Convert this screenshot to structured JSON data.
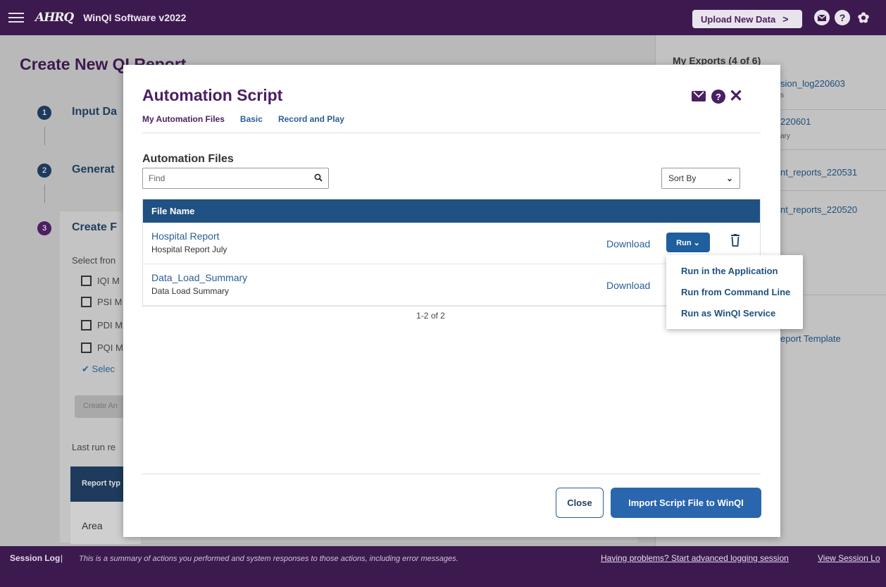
{
  "topbar": {
    "logo": "AHRQ",
    "app_title": "WinQI Software v2022",
    "upload_label": "Upload New Data",
    "upload_chevron": ">",
    "help_glyph": "?",
    "settings_glyph": "✿"
  },
  "background": {
    "page_title": "Create New QI Report",
    "steps": [
      {
        "number": "1",
        "label": "Input Da"
      },
      {
        "number": "2",
        "label": "Generat"
      },
      {
        "number": "3",
        "label": "Create F"
      }
    ],
    "select_from": "Select fron",
    "checkboxes": [
      "IQI M",
      "PSI M",
      "PDI M",
      "PQI M"
    ],
    "select_all": "Selec",
    "create_btn": "Create An",
    "last_run": "Last run re",
    "table_header": "Report typ",
    "table_cell": "Area",
    "right_panel": {
      "title": "My Exports (4 of 6)",
      "items": [
        {
          "name": "sion_log220603",
          "sub": "s"
        },
        {
          "name": "220601",
          "sub": "ary"
        },
        {
          "name": "nt_reports_220531",
          "sub": ""
        },
        {
          "name": "nt_reports_220520",
          "sub": ""
        }
      ],
      "template_link": "eport Template"
    }
  },
  "footer": {
    "label": "Session Log",
    "separator": "|",
    "description": "This is a summary of actions you performed and system responses to those actions, including error messages.",
    "link_problems": "Having problems? Start advanced logging session",
    "link_view": "View Session Lo"
  },
  "modal": {
    "title": "Automation Script",
    "help_glyph": "?",
    "close_glyph": "✕",
    "tabs": [
      "My Automation Files",
      "Basic",
      "Record and Play"
    ],
    "section_title": "Automation Files",
    "search_placeholder": "Find",
    "sort_label": "Sort By",
    "sort_chevron": "⌄",
    "table_header": "File Name",
    "rows": [
      {
        "name": "Hospital Report",
        "description": "Hospital Report July",
        "download": "Download",
        "run": "Run ⌄"
      },
      {
        "name": "Data_Load_Summary",
        "description": "Data Load Summary",
        "download": "Download"
      }
    ],
    "pager": "1-2 of 2",
    "close_button": "Close",
    "import_button": "Import Script File to WinQI"
  },
  "run_menu": [
    "Run in the Application",
    "Run from Command Line",
    "Run as WinQI Service"
  ]
}
